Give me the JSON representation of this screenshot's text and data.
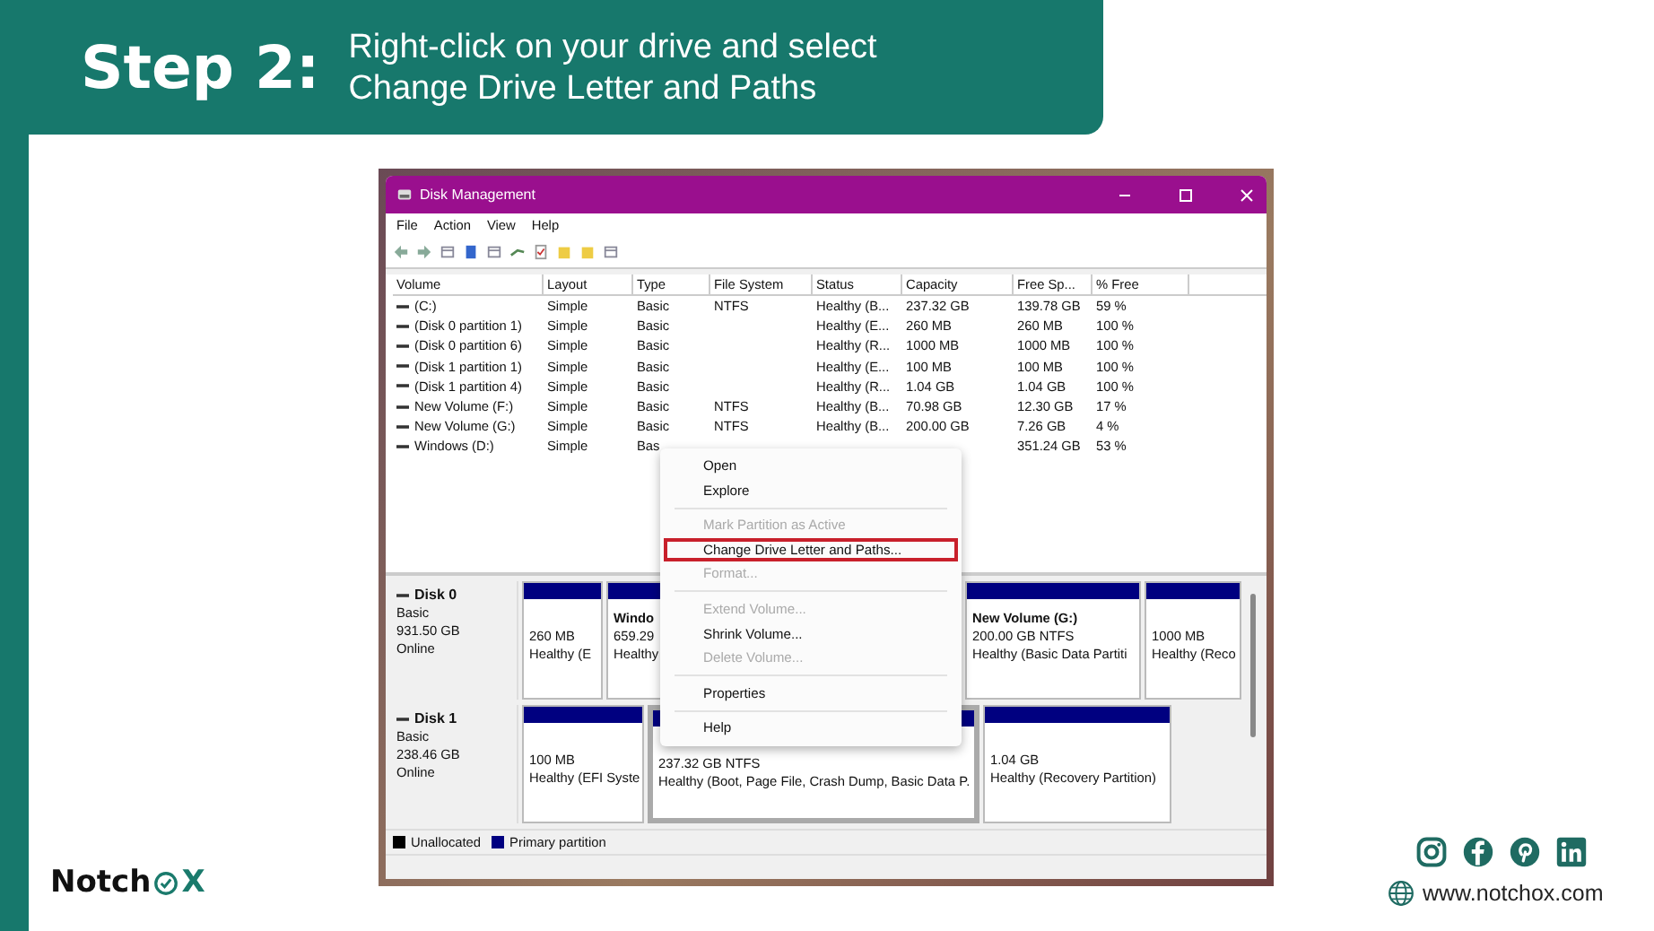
{
  "header": {
    "step": "Step 2:",
    "instruction_lines": [
      "Right-click on your drive and select",
      "Change Drive Letter and Paths"
    ]
  },
  "window": {
    "title": "Disk Management",
    "menu": [
      "File",
      "Action",
      "View",
      "Help"
    ]
  },
  "table": {
    "columns": [
      "Volume",
      "Layout",
      "Type",
      "File System",
      "Status",
      "Capacity",
      "Free Sp...",
      "% Free"
    ],
    "rows": [
      {
        "cells": [
          "(C:)",
          "Simple",
          "Basic",
          "NTFS",
          "Healthy (B...",
          "237.32 GB",
          "139.78 GB",
          "59 %"
        ]
      },
      {
        "cells": [
          "(Disk 0 partition 1)",
          "Simple",
          "Basic",
          "",
          "Healthy (E...",
          "260 MB",
          "260 MB",
          "100 %"
        ]
      },
      {
        "cells": [
          "(Disk 0 partition 6)",
          "Simple",
          "Basic",
          "",
          "Healthy (R...",
          "1000 MB",
          "1000 MB",
          "100 %"
        ]
      },
      {
        "cells": [
          "(Disk 1 partition 1)",
          "Simple",
          "Basic",
          "",
          "Healthy (E...",
          "100 MB",
          "100 MB",
          "100 %"
        ]
      },
      {
        "cells": [
          "(Disk 1 partition 4)",
          "Simple",
          "Basic",
          "",
          "Healthy (R...",
          "1.04 GB",
          "1.04 GB",
          "100 %"
        ]
      },
      {
        "cells": [
          "New Volume (F:)",
          "Simple",
          "Basic",
          "NTFS",
          "Healthy (B...",
          "70.98 GB",
          "12.30 GB",
          "17 %"
        ]
      },
      {
        "cells": [
          "New Volume (G:)",
          "Simple",
          "Basic",
          "NTFS",
          "Healthy (B...",
          "200.00 GB",
          "7.26 GB",
          "4 %"
        ]
      },
      {
        "cells": [
          "Windows (D:)",
          "Simple",
          "Bas",
          "",
          "",
          "",
          "351.24 GB",
          "53 %"
        ]
      }
    ]
  },
  "context_menu": [
    {
      "label": "Open",
      "disabled": false,
      "highlighted": false,
      "separator_before": false
    },
    {
      "label": "Explore",
      "disabled": false,
      "highlighted": false,
      "separator_before": false
    },
    {
      "label": "Mark Partition as Active",
      "disabled": true,
      "highlighted": false,
      "separator_before": true
    },
    {
      "label": "Change Drive Letter and Paths...",
      "disabled": false,
      "highlighted": true,
      "separator_before": false
    },
    {
      "label": "Format...",
      "disabled": true,
      "highlighted": false,
      "separator_before": false
    },
    {
      "label": "Extend Volume...",
      "disabled": true,
      "highlighted": false,
      "separator_before": true
    },
    {
      "label": "Shrink Volume...",
      "disabled": false,
      "highlighted": false,
      "separator_before": false
    },
    {
      "label": "Delete Volume...",
      "disabled": true,
      "highlighted": false,
      "separator_before": false
    },
    {
      "label": "Properties",
      "disabled": false,
      "highlighted": false,
      "separator_before": true
    },
    {
      "label": "Help",
      "disabled": false,
      "highlighted": false,
      "separator_before": true
    }
  ],
  "disks": [
    {
      "name": "Disk 0",
      "type": "Basic",
      "size": "931.50 GB",
      "status": "Online",
      "partitions": [
        {
          "lines": [
            "260 MB",
            "Healthy (E"
          ],
          "selected": false
        },
        {
          "title": "Windo",
          "lines": [
            "659.29",
            "Healthy"
          ],
          "selected": false
        },
        {
          "title": "New Volume  (G:)",
          "lines": [
            "200.00 GB NTFS",
            "Healthy (Basic Data Partiti"
          ],
          "selected": false
        },
        {
          "lines": [
            "1000 MB",
            "Healthy (Reco"
          ],
          "selected": false
        }
      ]
    },
    {
      "name": "Disk 1",
      "type": "Basic",
      "size": "238.46 GB",
      "status": "Online",
      "partitions": [
        {
          "lines": [
            "100 MB",
            "Healthy (EFI Syste"
          ],
          "selected": false
        },
        {
          "lines": [
            "237.32 GB NTFS",
            "Healthy (Boot, Page File, Crash Dump, Basic Data P."
          ],
          "selected": true
        },
        {
          "lines": [
            "1.04 GB",
            "Healthy (Recovery Partition)"
          ],
          "selected": false
        }
      ]
    }
  ],
  "legend": [
    {
      "label": "Unallocated",
      "color": "#000000"
    },
    {
      "label": "Primary partition",
      "color": "#000080"
    }
  ],
  "brand": {
    "name_start": "Notch",
    "name_end": "X",
    "website": "www.notchox.com"
  }
}
